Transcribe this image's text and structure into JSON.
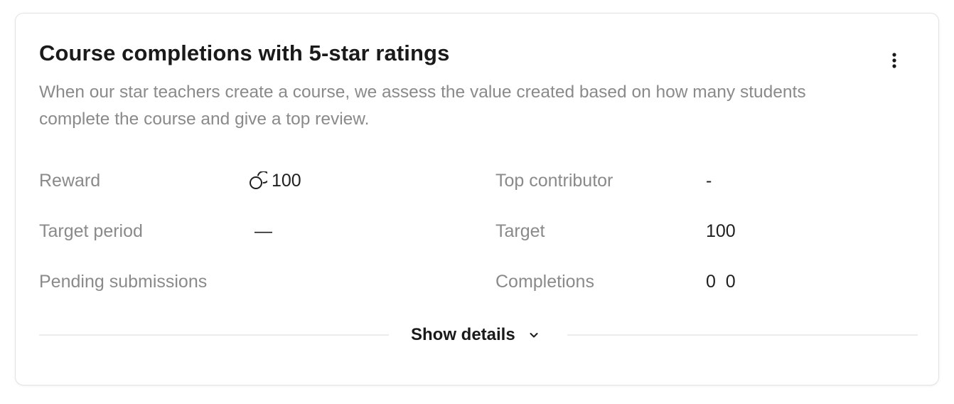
{
  "card": {
    "title": "Course completions with 5-star ratings",
    "description": "When our star teachers create a course, we assess the value created based on how many students complete the course and give a top review."
  },
  "fields": {
    "reward": {
      "label": "Reward",
      "value": "100",
      "icon": "coin-icon"
    },
    "target_period": {
      "label": "Target period",
      "value": "—"
    },
    "pending_submissions": {
      "label": "Pending submissions",
      "value": ""
    },
    "top_contributor": {
      "label": "Top contributor",
      "value": "-"
    },
    "target": {
      "label": "Target",
      "value": "100"
    },
    "completions": {
      "label": "Completions",
      "value": "0  0"
    }
  },
  "footer": {
    "show_details_label": "Show details",
    "icon": "chevron-down-icon"
  },
  "menu": {
    "icon": "more-vertical-icon"
  }
}
